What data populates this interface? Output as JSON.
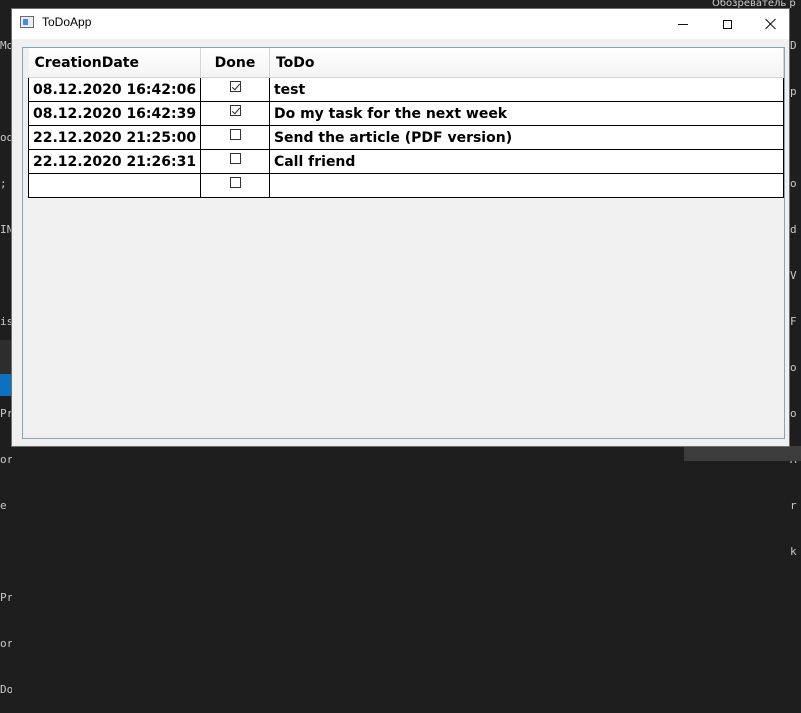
{
  "window": {
    "title": "ToDoApp"
  },
  "grid": {
    "columns": [
      "CreationDate",
      "Done",
      "ToDo"
    ],
    "rows": [
      {
        "date": "08.12.2020 16:42:06",
        "done": true,
        "todo": "test"
      },
      {
        "date": "08.12.2020 16:42:39",
        "done": true,
        "todo": "Do my task for the next week"
      },
      {
        "date": "22.12.2020 21:25:00",
        "done": false,
        "todo": "Send the article (PDF version)"
      },
      {
        "date": "22.12.2020 21:26:31",
        "done": false,
        "todo": "Call friend"
      },
      {
        "date": "",
        "done": false,
        "todo": ""
      }
    ]
  },
  "background": {
    "left_fragments": [
      "Mo",
      "",
      "od",
      "; 1",
      "IN",
      "",
      "is",
      "",
      "Pr",
      "or",
      "e",
      "",
      "Pr",
      "or",
      "Do"
    ],
    "right_fragments": [
      "D",
      "p",
      "",
      "o",
      "d",
      "V",
      "F",
      "o",
      "o",
      "A",
      "r",
      "k"
    ],
    "top_right_text": "Обозреватель р"
  }
}
